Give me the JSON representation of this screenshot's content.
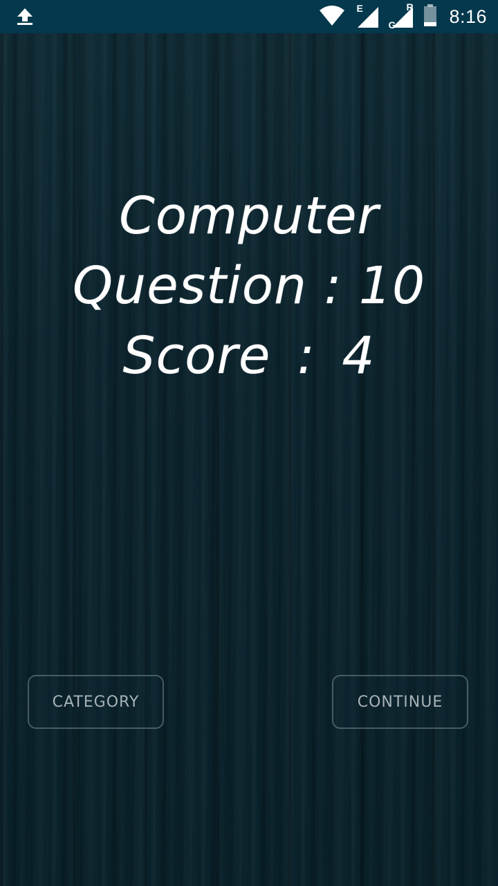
{
  "status_bar": {
    "upload_icon": "upload-arrow-icon",
    "wifi_icon": "wifi-icon",
    "signal_1": {
      "icon": "cell-signal-icon",
      "letter": "E"
    },
    "signal_2": {
      "icon": "cell-signal-icon",
      "letter_top": "R",
      "letter_bottom": "G"
    },
    "battery_icon": "battery-icon",
    "time": "8:16"
  },
  "result": {
    "category_name": "Computer",
    "question_label": "Question",
    "question_value": "10",
    "score_label": "Score",
    "score_value": "4",
    "separator": ":"
  },
  "buttons": {
    "category_label": "CATEGORY",
    "continue_label": "CONTINUE"
  },
  "colors": {
    "status_bar_bg": "#03384d",
    "background": "#0b232d",
    "text": "#ffffff",
    "button_text": "#a7b3b8"
  }
}
